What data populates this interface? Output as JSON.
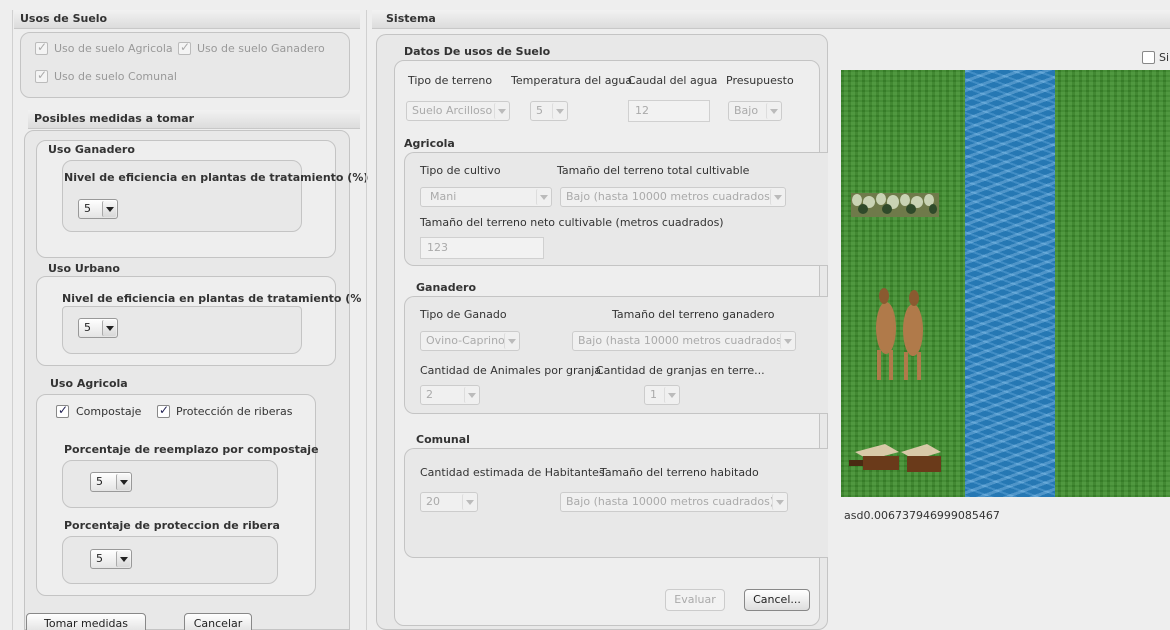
{
  "left": {
    "usos_title": "Usos de Suelo",
    "usos": [
      {
        "label": "Uso de suelo Agricola",
        "checked": true
      },
      {
        "label": "Uso de suelo Ganadero",
        "checked": true
      },
      {
        "label": "Uso de suelo Comunal",
        "checked": true
      }
    ],
    "medidas_title": "Posibles medidas a tomar",
    "ganadero": {
      "title": "Uso Ganadero",
      "box_title": "Nivel de eficiencia en plantas de tratamiento (%)",
      "value": "5"
    },
    "urbano": {
      "title": "Uso Urbano",
      "box_title": "Nivel de eficiencia en plantas de tratamiento (%",
      "value": "5"
    },
    "agricola": {
      "title": "Uso Agricola",
      "compostaje": {
        "label": "Compostaje",
        "checked": true
      },
      "riberas": {
        "label": "Protección de riberas",
        "checked": true
      },
      "reemplazo": {
        "title": "Porcentaje de reemplazo por compostaje",
        "value": "5"
      },
      "proteccion": {
        "title": "Porcentaje de proteccion de ribera",
        "value": "5"
      }
    },
    "buttons": {
      "tomar": "Tomar medidas",
      "cancelar": "Cancelar"
    }
  },
  "sistema": {
    "title": "Sistema",
    "datos_title": "Datos De usos de Suelo",
    "headers": {
      "tipo_terreno": "Tipo de terreno",
      "temperatura": "Temperatura del agua",
      "caudal": "Caudal del agua",
      "presupuesto": "Presupuesto"
    },
    "values": {
      "tipo_terreno": "Suelo Arcilloso",
      "temperatura": "5",
      "caudal": "12",
      "presupuesto": "Bajo"
    },
    "agricola": {
      "title": "Agricola",
      "tipo_cultivo_label": "Tipo de cultivo",
      "tamano_total_label": "Tamaño del terreno total cultivable",
      "tipo_cultivo": "Mani",
      "tamano_total": "Bajo (hasta 10000 metros cuadrados)",
      "neto_label": "Tamaño del terreno neto cultivable (metros cuadrados)",
      "neto": "123"
    },
    "ganadero": {
      "title": "Ganadero",
      "tipo_label": "Tipo de Ganado",
      "tamano_label": "Tamaño del terreno ganadero",
      "tipo": "Ovino-Caprino",
      "tamano": "Bajo (hasta 10000 metros cuadrados)",
      "animales_label": "Cantidad de Animales por granja",
      "granjas_label": "Cantidad de granjas en terre...",
      "animales": "2",
      "granjas": "1"
    },
    "comunal": {
      "title": "Comunal",
      "habitantes_label": "Cantidad estimada de Habitantes",
      "tamano_label": "Tamaño del terreno habitado",
      "habitantes": "20",
      "tamano": "Bajo (hasta 10000 metros cuadrados)"
    },
    "buttons": {
      "evaluar": "Evaluar",
      "cancel": "Cancel..."
    },
    "si_label": "Si",
    "readout": "asd0.006737946999085467"
  }
}
